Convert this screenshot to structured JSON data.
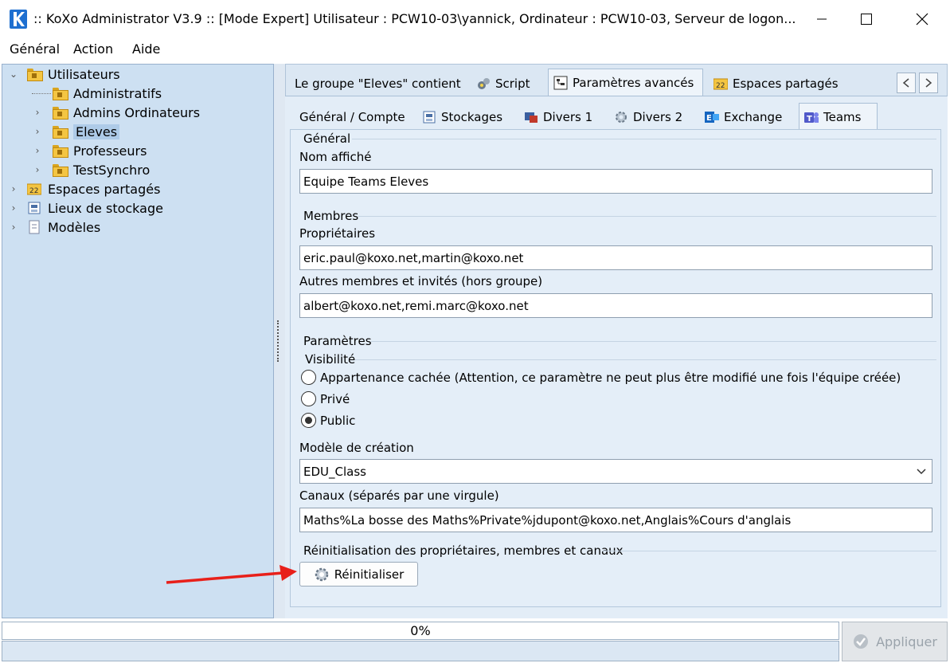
{
  "window": {
    "title": ":: KoXo Administrator V3.9 :: [Mode Expert] Utilisateur : PCW10-03\\yannick, Ordinateur : PCW10-03, Serveur de logon...",
    "app_icon_letter": "K"
  },
  "menu": [
    "Général",
    "Action",
    "Aide"
  ],
  "tree": {
    "items": [
      {
        "label": "Utilisateurs",
        "level": 0,
        "expanded": true
      },
      {
        "label": "Administratifs",
        "level": 1
      },
      {
        "label": "Admins Ordinateurs",
        "level": 1
      },
      {
        "label": "Eleves",
        "level": 1,
        "selected": true
      },
      {
        "label": "Professeurs",
        "level": 1
      },
      {
        "label": "TestSynchro",
        "level": 1
      },
      {
        "label": "Espaces partagés",
        "level": 0
      },
      {
        "label": "Lieux de stockage",
        "level": 0
      },
      {
        "label": "Modèles",
        "level": 0
      }
    ]
  },
  "main_tabs": [
    {
      "label": "Le groupe \"Eleves\" contient"
    },
    {
      "label": "Script",
      "icon": "script-icon"
    },
    {
      "label": "Paramètres avancés",
      "icon": "settings-tree-icon",
      "active": true
    },
    {
      "label": "Espaces partagés",
      "icon": "shared-spaces-icon"
    }
  ],
  "sub_tabs": [
    {
      "label": "Général / Compte"
    },
    {
      "label": "Stockages",
      "icon": "storage-icon"
    },
    {
      "label": "Divers 1",
      "icon": "divers-icon"
    },
    {
      "label": "Divers 2",
      "icon": "gear-icon"
    },
    {
      "label": "Exchange",
      "icon": "exchange-icon"
    },
    {
      "label": "Teams",
      "icon": "teams-icon",
      "active": true
    }
  ],
  "form": {
    "general": {
      "section": "Général",
      "display_name_label": "Nom affiché",
      "display_name_value": "Equipe Teams Eleves"
    },
    "members": {
      "section": "Membres",
      "owners_label": "Propriétaires",
      "owners_value": "eric.paul@koxo.net,martin@koxo.net",
      "others_label": "Autres membres et invités (hors groupe)",
      "others_value": "albert@koxo.net,remi.marc@koxo.net"
    },
    "params": {
      "section": "Paramètres",
      "visibility_label": "Visibilité",
      "options": [
        {
          "label": "Appartenance cachée (Attention, ce paramètre ne peut plus être modifié une fois l'équipe créée)",
          "checked": false
        },
        {
          "label": "Privé",
          "checked": false
        },
        {
          "label": "Public",
          "checked": true
        }
      ],
      "template_label": "Modèle de création",
      "template_value": "EDU_Class",
      "channels_label": "Canaux (séparés par une virgule)",
      "channels_value": "Maths%La bosse des Maths%Private%jdupont@koxo.net,Anglais%Cours d'anglais"
    },
    "reset": {
      "section": "Réinitialisation des propriétaires, membres et canaux",
      "button_label": "Réinitialiser"
    }
  },
  "status": {
    "progress_text": "0%",
    "progress_value": 0,
    "apply_label": "Appliquer"
  }
}
